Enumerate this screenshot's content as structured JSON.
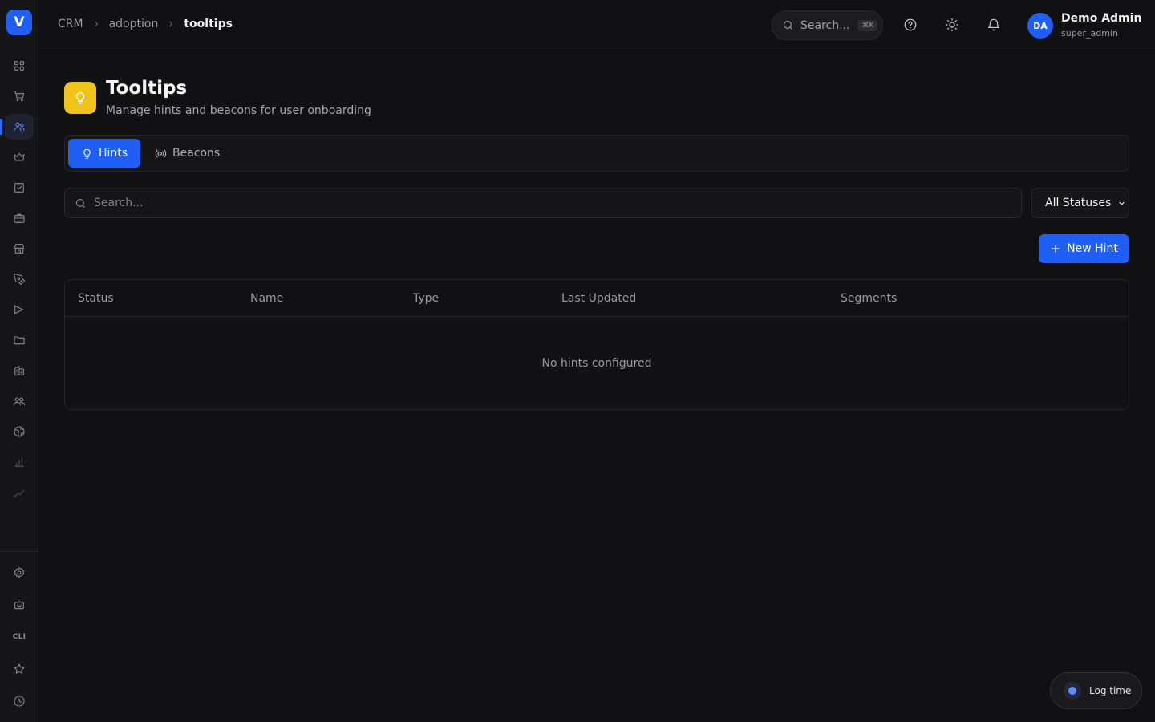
{
  "sidebar": {
    "logo": "V",
    "items": [
      {
        "icon": "grid-icon"
      },
      {
        "icon": "cart-icon"
      },
      {
        "icon": "users-icon",
        "active": true
      },
      {
        "icon": "crown-icon"
      },
      {
        "icon": "checkbox-icon"
      },
      {
        "icon": "briefcase-icon"
      },
      {
        "icon": "store-icon"
      },
      {
        "icon": "pen-tool-icon"
      },
      {
        "icon": "megaphone-icon"
      },
      {
        "icon": "folder-icon"
      },
      {
        "icon": "building-icon"
      },
      {
        "icon": "team-icon"
      },
      {
        "icon": "globe-icon"
      },
      {
        "icon": "bar-chart-icon"
      },
      {
        "icon": "trend-icon"
      }
    ],
    "bottom": {
      "settings_icon": "gear-icon",
      "bot_icon": "robot-icon",
      "cli_label": "CLI",
      "star_icon": "star-icon",
      "clock_icon": "clock-icon"
    }
  },
  "topbar": {
    "breadcrumb": [
      "CRM",
      "adoption",
      "tooltips"
    ],
    "search_label": "Search...",
    "search_shortcut": "⌘K",
    "user": {
      "initials": "DA",
      "name": "Demo Admin",
      "role": "super_admin"
    }
  },
  "header": {
    "title": "Tooltips",
    "subtitle": "Manage hints and beacons for user onboarding",
    "accent": "#f0c419"
  },
  "tabs": [
    {
      "label": "Hints",
      "active": true
    },
    {
      "label": "Beacons",
      "active": false
    }
  ],
  "filters": {
    "search_placeholder": "Search...",
    "status_selected": "All Statuses"
  },
  "actions": {
    "new_label": "New Hint"
  },
  "table": {
    "columns": [
      "Status",
      "Name",
      "Type",
      "Last Updated",
      "Segments"
    ],
    "rows": [],
    "empty_message": "No hints configured"
  },
  "floating": {
    "log_time_label": "Log time"
  },
  "colors": {
    "primary": "#1f5ff5",
    "background": "#111113"
  }
}
